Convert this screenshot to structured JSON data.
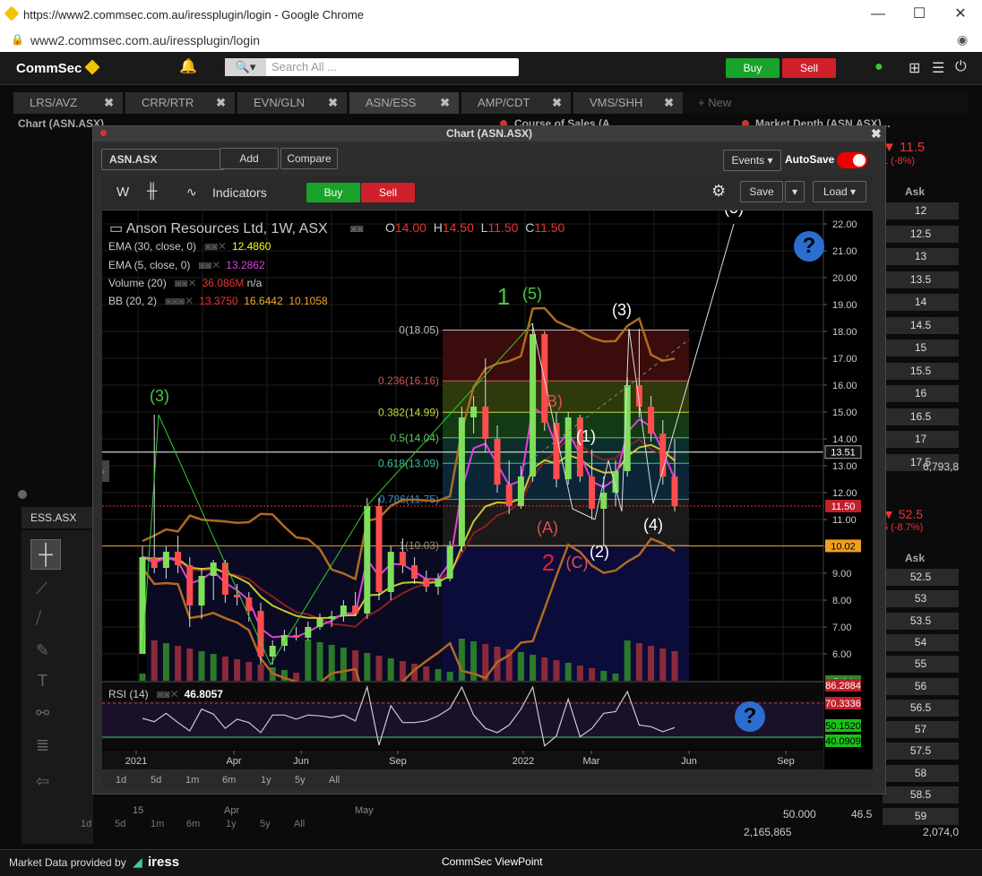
{
  "browser": {
    "title": "https://www2.commsec.com.au/iressplugin/login - Google Chrome",
    "url": "www2.commsec.com.au/iressplugin/login"
  },
  "app": {
    "logo": "CommSec",
    "search_placeholder": "Search All ...",
    "buy": "Buy",
    "sell": "Sell"
  },
  "tabs": [
    "LRS/AVZ",
    "CRR/RTR",
    "EVN/GLN",
    "ASN/ESS",
    "AMP/CDT",
    "VMS/SHH",
    "+ New"
  ],
  "left_panel": {
    "title": "Chart (ASN.ASX)",
    "symbol": "ESS.ASX"
  },
  "right_panels": {
    "course_title": "Course of Sales (A...",
    "depth_title": "Market Depth (ASN.ASX)...",
    "last": "11.5",
    "change": "1 (-8%)",
    "ask_header": "Ask",
    "asks": [
      "12",
      "12.5",
      "13",
      "13.5",
      "14",
      "14.5",
      "15",
      "15.5",
      "16",
      "16.5",
      "17",
      "17.5"
    ],
    "total": "6,793,8",
    "last2": "52.5",
    "change2": "5 (-8.7%)",
    "ask_header2": "Ask",
    "asks2": [
      "52.5",
      "53",
      "53.5",
      "54",
      "55",
      "56",
      "56.5",
      "57",
      "57.5",
      "58",
      "58.5",
      "59"
    ],
    "bottom_vals": [
      "50.000",
      "46.5",
      "2,165,865",
      "2,074,0"
    ]
  },
  "chart_window": {
    "title": "Chart (ASN.ASX)",
    "symbol": "ASN.ASX",
    "add": "Add",
    "compare": "Compare",
    "events": "Events",
    "autosave": "AutoSave",
    "interval": "W",
    "indicators": "Indicators",
    "buy": "Buy",
    "sell": "Sell",
    "save": "Save",
    "load": "Load",
    "ranges": [
      "1d",
      "5d",
      "1m",
      "6m",
      "1y",
      "5y",
      "All"
    ]
  },
  "legend": {
    "name": "Anson Resources Ltd, 1W, ASX",
    "o": "14.00",
    "h": "14.50",
    "l": "11.50",
    "c": "11.50",
    "ema30_label": "EMA (30, close, 0)",
    "ema30_val": "12.4860",
    "ema5_label": "EMA (5, close, 0)",
    "ema5_val": "13.2862",
    "vol_label": "Volume (20)",
    "vol_val": "36.086M",
    "vol_na": "n/a",
    "bb_label": "BB (20, 2)",
    "bb_v1": "13.3750",
    "bb_v2": "16.6442",
    "bb_v3": "10.1058",
    "rsi_label": "RSI (14)",
    "rsi_val": "46.8057"
  },
  "bottom_left": {
    "ranges": [
      "1d",
      "5d",
      "1m",
      "6m",
      "1y",
      "5y",
      "All"
    ],
    "months": [
      "15",
      "Apr",
      "May"
    ]
  },
  "footer": {
    "provider": "Market Data provided by",
    "brand": "iress",
    "center": "CommSec ViewPoint"
  },
  "chart_data": {
    "type": "candlestick",
    "y_ticks": [
      6,
      7,
      8,
      9,
      10,
      11,
      12,
      13,
      14,
      15,
      16,
      17,
      18,
      19,
      20,
      21,
      22
    ],
    "y_tick_labels": [
      "6.00",
      "7.00",
      "8.00",
      "9.00",
      "10.00",
      "11.00",
      "12.00",
      "13.00",
      "14.00",
      "15.00",
      "16.00",
      "17.00",
      "18.00",
      "19.00",
      "20.00",
      "21.00",
      "22.00"
    ],
    "x_labels": [
      "2021",
      "Apr",
      "Jun",
      "Sep",
      "2022",
      "Mar",
      "Jun",
      "Sep"
    ],
    "price_tags": [
      "13.51",
      "11.50",
      "10.02",
      "5.04",
      "86.2884",
      "70.3336",
      "50.1520",
      "40.0909"
    ],
    "fib_levels": [
      {
        "label": "0(18.05)",
        "value": 18.05,
        "color": "#bbbbbb"
      },
      {
        "label": "0.236(16.16)",
        "value": 16.16,
        "color": "#d9534f"
      },
      {
        "label": "0.382(14.99)",
        "value": 14.99,
        "color": "#c8d840"
      },
      {
        "label": "0.5(14.04)",
        "value": 14.04,
        "color": "#5cc85c"
      },
      {
        "label": "0.618(13.09)",
        "value": 13.09,
        "color": "#3cbfa0"
      },
      {
        "label": "0.786(11.75)",
        "value": 11.75,
        "color": "#3c8fc8"
      },
      {
        "label": "1(10.03)",
        "value": 10.03,
        "color": "#888888"
      }
    ],
    "wave_labels": [
      "(3)",
      "1",
      "(5)",
      "(3)",
      "(B)",
      "(1)",
      "(A)",
      "2",
      "(C)",
      "(2)",
      "(4)",
      "(5)"
    ],
    "candles": [
      {
        "o": 6.0,
        "h": 10.0,
        "l": 6.0,
        "c": 9.6
      },
      {
        "o": 9.6,
        "h": 14.9,
        "l": 9.0,
        "c": 9.2
      },
      {
        "o": 9.2,
        "h": 10.0,
        "l": 8.8,
        "c": 9.8
      },
      {
        "o": 9.8,
        "h": 10.4,
        "l": 9.0,
        "c": 9.3
      },
      {
        "o": 9.3,
        "h": 9.6,
        "l": 7.0,
        "c": 7.8
      },
      {
        "o": 7.8,
        "h": 9.2,
        "l": 7.3,
        "c": 8.9
      },
      {
        "o": 8.9,
        "h": 9.5,
        "l": 8.0,
        "c": 9.4
      },
      {
        "o": 9.4,
        "h": 9.5,
        "l": 7.9,
        "c": 8.2
      },
      {
        "o": 8.2,
        "h": 8.6,
        "l": 7.8,
        "c": 8.1
      },
      {
        "o": 8.1,
        "h": 8.3,
        "l": 7.2,
        "c": 7.6
      },
      {
        "o": 7.6,
        "h": 7.9,
        "l": 5.6,
        "c": 5.9
      },
      {
        "o": 5.9,
        "h": 6.5,
        "l": 5.6,
        "c": 6.3
      },
      {
        "o": 6.3,
        "h": 6.9,
        "l": 6.1,
        "c": 6.7
      },
      {
        "o": 6.7,
        "h": 7.0,
        "l": 6.5,
        "c": 6.6
      },
      {
        "o": 6.6,
        "h": 7.2,
        "l": 6.5,
        "c": 7.0
      },
      {
        "o": 7.0,
        "h": 7.5,
        "l": 6.9,
        "c": 7.3
      },
      {
        "o": 7.3,
        "h": 7.6,
        "l": 7.0,
        "c": 7.4
      },
      {
        "o": 7.4,
        "h": 8.0,
        "l": 7.2,
        "c": 7.8
      },
      {
        "o": 7.8,
        "h": 8.3,
        "l": 7.4,
        "c": 7.5
      },
      {
        "o": 7.5,
        "h": 11.8,
        "l": 7.3,
        "c": 11.5
      },
      {
        "o": 11.5,
        "h": 11.8,
        "l": 8.0,
        "c": 8.3
      },
      {
        "o": 8.3,
        "h": 10.0,
        "l": 8.0,
        "c": 9.8
      },
      {
        "o": 9.8,
        "h": 10.3,
        "l": 9.0,
        "c": 9.3
      },
      {
        "o": 9.3,
        "h": 9.6,
        "l": 8.6,
        "c": 8.8
      },
      {
        "o": 8.8,
        "h": 9.1,
        "l": 8.3,
        "c": 8.5
      },
      {
        "o": 8.5,
        "h": 9.0,
        "l": 8.2,
        "c": 8.8
      },
      {
        "o": 8.8,
        "h": 10.2,
        "l": 8.7,
        "c": 10.0
      },
      {
        "o": 10.0,
        "h": 15.2,
        "l": 9.8,
        "c": 14.8
      },
      {
        "o": 14.8,
        "h": 15.6,
        "l": 14.2,
        "c": 15.2
      },
      {
        "o": 15.2,
        "h": 17.0,
        "l": 13.5,
        "c": 14.0
      },
      {
        "o": 14.0,
        "h": 14.5,
        "l": 12.0,
        "c": 12.3
      },
      {
        "o": 12.3,
        "h": 13.2,
        "l": 11.2,
        "c": 11.5
      },
      {
        "o": 11.5,
        "h": 13.0,
        "l": 11.4,
        "c": 12.6
      },
      {
        "o": 12.6,
        "h": 18.3,
        "l": 12.4,
        "c": 17.9
      },
      {
        "o": 17.9,
        "h": 18.0,
        "l": 14.3,
        "c": 14.6
      },
      {
        "o": 14.6,
        "h": 15.0,
        "l": 12.2,
        "c": 12.5
      },
      {
        "o": 12.5,
        "h": 15.0,
        "l": 12.3,
        "c": 14.8
      },
      {
        "o": 14.8,
        "h": 14.9,
        "l": 12.4,
        "c": 12.6
      },
      {
        "o": 12.6,
        "h": 13.6,
        "l": 11.0,
        "c": 11.4
      },
      {
        "o": 11.4,
        "h": 12.6,
        "l": 10.0,
        "c": 12.0
      },
      {
        "o": 12.0,
        "h": 13.2,
        "l": 11.5,
        "c": 12.8
      },
      {
        "o": 12.8,
        "h": 16.3,
        "l": 12.6,
        "c": 16.0
      },
      {
        "o": 16.0,
        "h": 18.1,
        "l": 14.8,
        "c": 15.2
      },
      {
        "o": 15.2,
        "h": 15.6,
        "l": 13.9,
        "c": 14.2
      },
      {
        "o": 14.2,
        "h": 14.7,
        "l": 12.3,
        "c": 12.6
      },
      {
        "o": 12.6,
        "h": 14.0,
        "l": 11.3,
        "c": 11.5
      }
    ]
  }
}
